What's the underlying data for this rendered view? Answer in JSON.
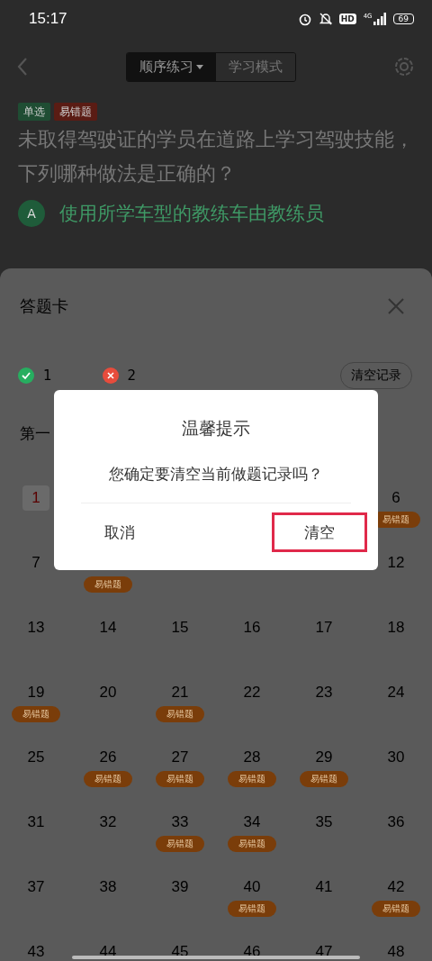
{
  "status_bar": {
    "time": "15:17",
    "hd": "HD",
    "network": "4G",
    "battery": "69"
  },
  "nav": {
    "modes": [
      {
        "label": "顺序练习",
        "selected": true,
        "dropdown": true
      },
      {
        "label": "学习模式",
        "selected": false,
        "dropdown": false
      }
    ]
  },
  "question": {
    "tags": [
      {
        "label": "单选",
        "color": "#1f4d33"
      },
      {
        "label": "易错题",
        "color": "#5a1c14"
      }
    ],
    "text": "未取得驾驶证的学员在道路上学习驾驶技能，下列哪种做法是正确的？",
    "option": {
      "letter": "A",
      "text": "使用所学车型的教练车由教练员"
    }
  },
  "answer_sheet": {
    "title": "答题卡",
    "correct": "1",
    "wrong": "2",
    "clear_button": "清空记录",
    "section": "第一",
    "cells": [
      {
        "number": "1",
        "selected": true
      },
      {},
      {},
      {},
      {},
      {
        "number": "6",
        "selected": false,
        "badge": "易错题"
      },
      {
        "number": "7",
        "selected": false
      },
      {
        "badge": "易错题"
      },
      {},
      {},
      {},
      {
        "number": "12",
        "selected": false
      },
      {
        "number": "13",
        "selected": false
      },
      {
        "number": "14",
        "selected": false
      },
      {
        "number": "15",
        "selected": false
      },
      {
        "number": "16",
        "selected": false
      },
      {
        "number": "17",
        "selected": false
      },
      {
        "number": "18",
        "selected": false
      },
      {
        "number": "19",
        "selected": false,
        "badge": "易错题"
      },
      {
        "number": "20",
        "selected": false
      },
      {
        "number": "21",
        "selected": false,
        "badge": "易错题"
      },
      {
        "number": "22",
        "selected": false
      },
      {
        "number": "23",
        "selected": false
      },
      {
        "number": "24",
        "selected": false
      },
      {
        "number": "25",
        "selected": false
      },
      {
        "number": "26",
        "selected": false,
        "badge": "易错题"
      },
      {
        "number": "27",
        "selected": false,
        "badge": "易错题"
      },
      {
        "number": "28",
        "selected": false,
        "badge": "易错题"
      },
      {
        "number": "29",
        "selected": false,
        "badge": "易错题"
      },
      {
        "number": "30",
        "selected": false
      },
      {
        "number": "31",
        "selected": false
      },
      {
        "number": "32",
        "selected": false
      },
      {
        "number": "33",
        "selected": false,
        "badge": "易错题"
      },
      {
        "number": "34",
        "selected": false,
        "badge": "易错题"
      },
      {
        "number": "35",
        "selected": false
      },
      {
        "number": "36",
        "selected": false
      },
      {
        "number": "37",
        "selected": false
      },
      {
        "number": "38",
        "selected": false
      },
      {
        "number": "39",
        "selected": false
      },
      {
        "number": "40",
        "selected": false,
        "badge": "易错题"
      },
      {
        "number": "41",
        "selected": false
      },
      {
        "number": "42",
        "selected": false,
        "badge": "易错题"
      },
      {
        "number": "43",
        "selected": false
      },
      {
        "number": "44",
        "selected": false
      },
      {
        "number": "45",
        "selected": false
      },
      {
        "number": "46",
        "selected": false
      },
      {
        "number": "47",
        "selected": false
      },
      {
        "number": "48",
        "selected": false
      }
    ]
  },
  "dialog": {
    "title": "温馨提示",
    "message": "您确定要清空当前做题记录吗？",
    "buttons": [
      {
        "label": "取消",
        "highlighted": false
      },
      {
        "label": "清空",
        "highlighted": true
      }
    ]
  }
}
